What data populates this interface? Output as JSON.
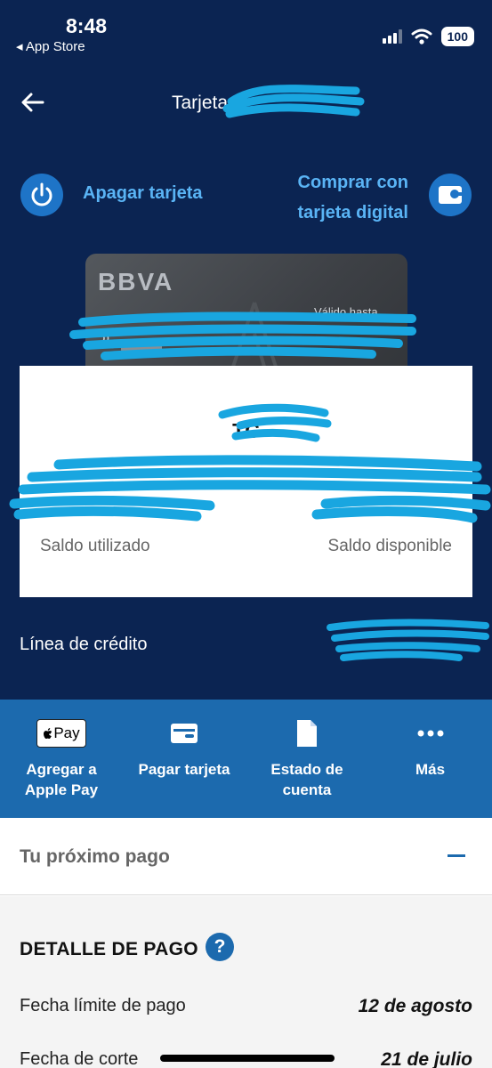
{
  "status_bar": {
    "time": "8:48",
    "back_app_label": "◂ App Store",
    "battery": "100"
  },
  "header": {
    "title": "Tarjeta"
  },
  "quick_actions": {
    "power_label": "Apagar tarjeta",
    "digital_line1": "Comprar con",
    "digital_line2": "tarjeta digital"
  },
  "card": {
    "brand": "BBVA",
    "valid_label": "Válido hasta"
  },
  "balance": {
    "title": "TC",
    "used_label": "Saldo utilizado",
    "available_label": "Saldo disponible"
  },
  "credit_line_label": "Línea de crédito",
  "actions": [
    {
      "icon": "apple-pay-icon",
      "label_line1": "Agregar a",
      "label_line2": "Apple Pay",
      "badge": "Pay"
    },
    {
      "icon": "card-payment-icon",
      "label_line1": "Pagar tarjeta",
      "label_line2": ""
    },
    {
      "icon": "document-icon",
      "label_line1": "Estado de",
      "label_line2": "cuenta"
    },
    {
      "icon": "more-icon",
      "label_line1": "Más",
      "label_line2": ""
    }
  ],
  "next_payment": {
    "label": "Tu próximo pago"
  },
  "payment_detail": {
    "title": "DETALLE DE PAGO",
    "help": "?",
    "rows": [
      {
        "label": "Fecha límite de pago",
        "value": "12 de agosto"
      },
      {
        "label": "Fecha de corte",
        "value": "21 de julio"
      }
    ]
  },
  "colors": {
    "header_bg": "#0b2452",
    "accent": "#1c6aae",
    "link": "#5ab4f5",
    "redaction": "#19a6e0"
  }
}
